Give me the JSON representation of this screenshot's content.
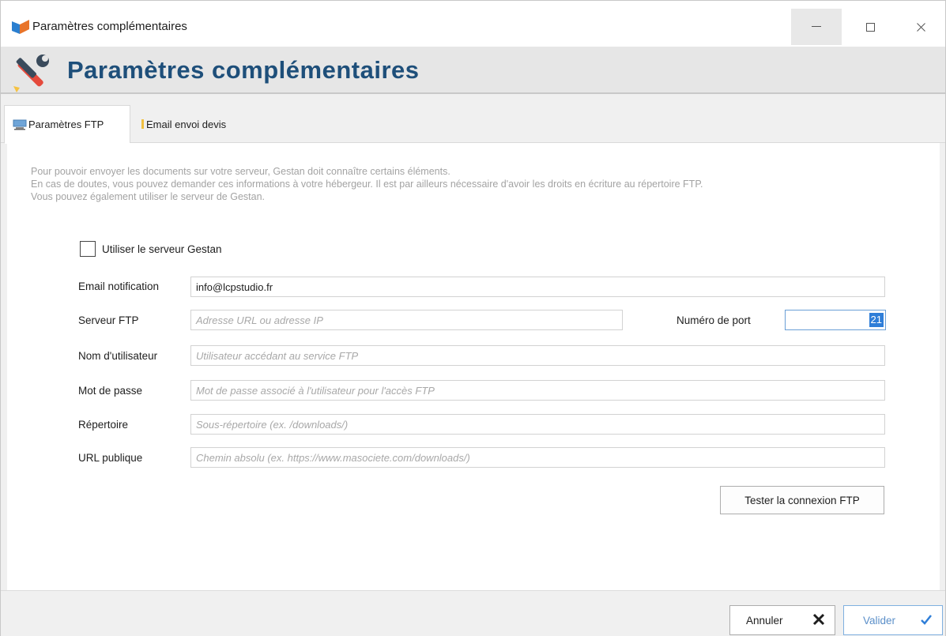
{
  "window": {
    "title": "Paramètres complémentaires",
    "controls": {
      "minimize": "—",
      "maximize": "☐",
      "close": "✕"
    }
  },
  "header": {
    "title": "Paramètres complémentaires",
    "icon": "tools-icon"
  },
  "tabs": [
    {
      "label": "Paramètres FTP",
      "icon": "server-icon",
      "active": true
    },
    {
      "label": "Email envoi devis",
      "icon": "email-icon",
      "active": false
    }
  ],
  "content": {
    "description": [
      "Pour pouvoir envoyer les documents sur votre serveur, Gestan doit connaître certains éléments.",
      "En cas de doutes, vous pouvez demander ces informations à votre hébergeur. Il est par ailleurs nécessaire d'avoir les droits en écriture au répertoire FTP.",
      "Vous pouvez également utiliser le serveur de Gestan."
    ],
    "use_gestan_server": {
      "label": "Utiliser le serveur Gestan",
      "checked": false
    },
    "fields": {
      "email": {
        "label": "Email notification",
        "value": "info@lcpstudio.fr",
        "placeholder": ""
      },
      "server": {
        "label": "Serveur FTP",
        "value": "",
        "placeholder": "Adresse URL ou adresse IP"
      },
      "user": {
        "label": "Nom d'utilisateur",
        "value": "",
        "placeholder": "Utilisateur accédant au service FTP"
      },
      "password": {
        "label": "Mot de passe",
        "value": "",
        "placeholder": "Mot de passe associé à l'utilisateur pour l'accès FTP"
      },
      "directory": {
        "label": "Répertoire",
        "value": "",
        "placeholder": "Sous-répertoire (ex. /downloads/)"
      },
      "public_url": {
        "label": "URL publique",
        "value": "",
        "placeholder": "Chemin absolu (ex. https://www.masociete.com/downloads/)"
      }
    },
    "port": {
      "label": "Numéro de port",
      "value": "21"
    },
    "test_button": "Tester la connexion FTP"
  },
  "footer": {
    "cancel_label": "Annuler",
    "ok_label": "Valider"
  },
  "colors": {
    "heading": "#1e4f7a",
    "accent": "#2f7ed8",
    "placeholder": "#a8a8a8",
    "description": "#a3a3a3"
  }
}
